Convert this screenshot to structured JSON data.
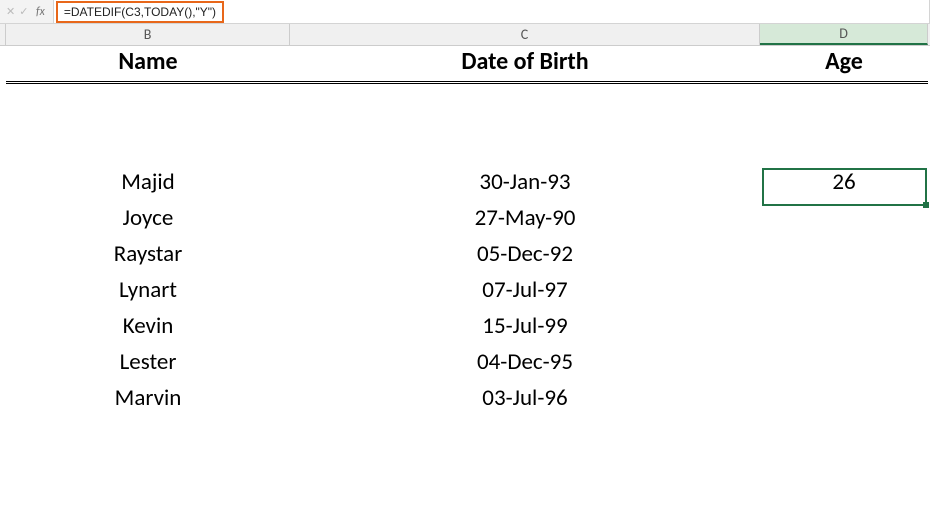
{
  "formula_bar": {
    "fx": "fx",
    "formula": "=DATEDIF(C3,TODAY(),\"Y\")"
  },
  "columns": {
    "B": "B",
    "C": "C",
    "D": "D"
  },
  "headers": {
    "name": "Name",
    "dob": "Date of Birth",
    "age": "Age"
  },
  "rows": [
    {
      "name": "Majid",
      "dob": "30-Jan-93",
      "age": "26"
    },
    {
      "name": "Joyce",
      "dob": "27-May-90",
      "age": ""
    },
    {
      "name": "Raystar",
      "dob": "05-Dec-92",
      "age": ""
    },
    {
      "name": "Lynart",
      "dob": "07-Jul-97",
      "age": ""
    },
    {
      "name": "Kevin",
      "dob": "15-Jul-99",
      "age": ""
    },
    {
      "name": "Lester",
      "dob": "04-Dec-95",
      "age": ""
    },
    {
      "name": "Marvin",
      "dob": "03-Jul-96",
      "age": ""
    }
  ]
}
